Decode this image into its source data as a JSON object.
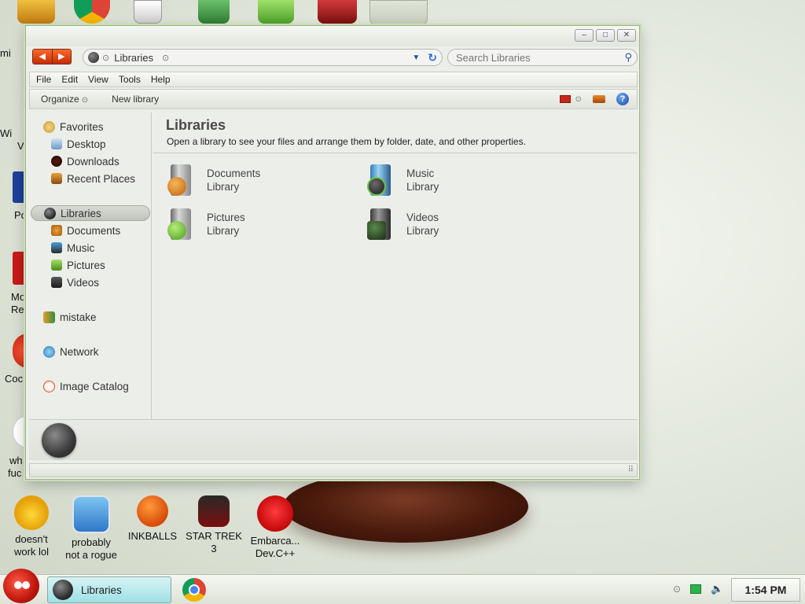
{
  "window": {
    "minimize": "–",
    "maximize": "□",
    "close": "✕"
  },
  "address_bar": {
    "back": "◀",
    "forward": "▶",
    "path": "Libraries",
    "search_placeholder": "Search Libraries"
  },
  "menu": [
    "File",
    "Edit",
    "View",
    "Tools",
    "Help"
  ],
  "commands": {
    "organize": "Organize",
    "new_library": "New library",
    "help": "?"
  },
  "nav": {
    "favorites": "Favorites",
    "favorites_items": [
      "Desktop",
      "Downloads",
      "Recent Places"
    ],
    "libraries": "Libraries",
    "libraries_items": [
      "Documents",
      "Music",
      "Pictures",
      "Videos"
    ],
    "homegroup": "mistake",
    "network": "Network",
    "catalog": "Image Catalog"
  },
  "content": {
    "title": "Libraries",
    "subtitle": "Open a library to see your files and arrange them by folder, date, and other properties.",
    "libraries": [
      {
        "name": "Documents",
        "type": "Library",
        "badge_color": "#e08a1e"
      },
      {
        "name": "Music",
        "type": "Library",
        "badge_color": "#3a3a3a"
      },
      {
        "name": "Pictures",
        "type": "Library",
        "badge_color": "#6fc23a"
      },
      {
        "name": "Videos",
        "type": "Library",
        "badge_color": "#2a2a2a"
      }
    ]
  },
  "desktop_icons": [
    {
      "label_line1": "doesn't",
      "label_line2": "work lol"
    },
    {
      "label_line1": "probably",
      "label_line2": "not a rogue"
    },
    {
      "label_line1": "INKBALLS",
      "label_line2": ""
    },
    {
      "label_line1": "STAR TREK",
      "label_line2": "3"
    },
    {
      "label_line1": "Embarca...",
      "label_line2": "Dev.C++"
    }
  ],
  "desktop_left_edge": [
    "mi",
    "Wi",
    "V",
    "Po",
    "Mo",
    "Re",
    "Coc",
    "wh",
    "fuc"
  ],
  "taskbar": {
    "active_window": "Libraries",
    "clock": "1:54 PM"
  },
  "colors": {
    "accent": "#c42b05",
    "task_highlight": "#9fe0e6",
    "window_border": "#9fb58a"
  }
}
